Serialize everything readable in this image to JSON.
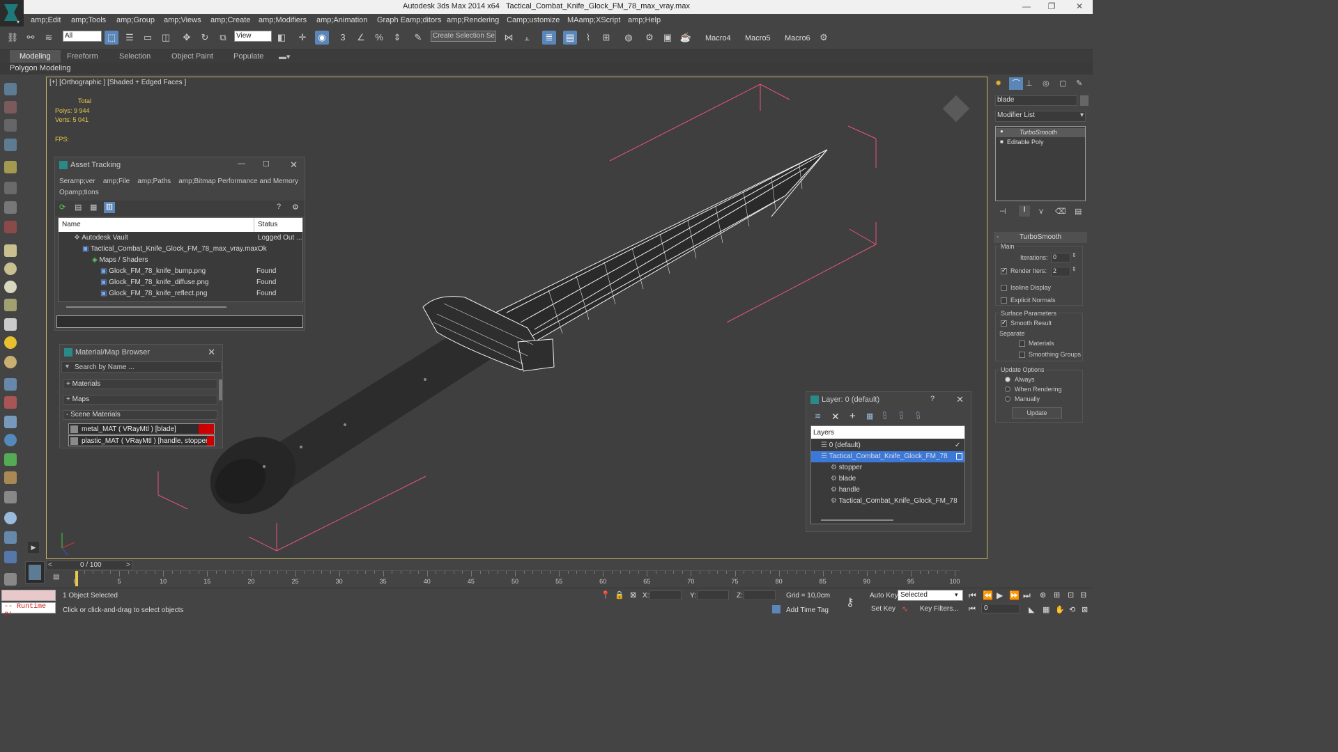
{
  "window": {
    "app_title": "Autodesk 3ds Max  2014 x64",
    "file_title": "Tactical_Combat_Knife_Glock_FM_78_max_vray.max"
  },
  "menu": [
    "amp;Edit",
    "amp;Tools",
    "amp;Group",
    "amp;Views",
    "amp;Create",
    "amp;Modifiers",
    "amp;Animation",
    "Graph Eamp;ditors",
    "amp;Rendering",
    "Camp;ustomize",
    "MAamp;XScript",
    "amp;Help"
  ],
  "toolbar": {
    "filter_select": "All",
    "ref_coord_select": "View",
    "selection_set": "Create Selection Se",
    "macros": [
      "Macro4",
      "Macro5",
      "Macro6"
    ]
  },
  "ribbon": {
    "tabs": [
      "Modeling",
      "Freeform",
      "Selection",
      "Object Paint",
      "Populate"
    ],
    "sub_label": "Polygon Modeling"
  },
  "viewport": {
    "label": "[+] [Orthographic ] [Shaded + Edged Faces ]",
    "stats_header": "Total",
    "polys_label": "Polys:",
    "polys_value": "9 944",
    "verts_label": "Verts:",
    "verts_value": "5 041",
    "fps_label": "FPS:"
  },
  "asset_tracking": {
    "title": "Asset Tracking",
    "menu": [
      "Seramp;ver",
      "amp;File",
      "amp;Paths",
      "amp;Bitmap Performance and Memory",
      "Opamp;tions"
    ],
    "columns": [
      "Name",
      "Status"
    ],
    "rows": [
      {
        "name": "Autodesk Vault",
        "status": "Logged Out ..."
      },
      {
        "name": "Tactical_Combat_Knife_Glock_FM_78_max_vray.max",
        "status": "Ok"
      },
      {
        "name": "Maps / Shaders",
        "status": ""
      },
      {
        "name": "Glock_FM_78_knife_bump.png",
        "status": "Found"
      },
      {
        "name": "Glock_FM_78_knife_diffuse.png",
        "status": "Found"
      },
      {
        "name": "Glock_FM_78_knife_reflect.png",
        "status": "Found"
      }
    ]
  },
  "material_browser": {
    "title": "Material/Map Browser",
    "search_placeholder": "Search by Name ...",
    "categories": [
      "+ Materials",
      "+ Maps",
      "- Scene Materials"
    ],
    "items": [
      "metal_MAT  ( VRayMtl )  [blade]",
      "plastic_MAT  ( VRayMtl )  [handle, stopper]"
    ]
  },
  "layer_panel": {
    "title": "Layer: 0 (default)",
    "help": "?",
    "header": "Layers",
    "items": [
      "0 (default)",
      "Tactical_Combat_Knife_Glock_FM_78",
      "stopper",
      "blade",
      "handle",
      "Tactical_Combat_Knife_Glock_FM_78"
    ]
  },
  "command_panel": {
    "object_name": "blade",
    "modifier_list": "Modifier List",
    "stack": [
      "TurboSmooth",
      "Editable Poly"
    ],
    "rollout_title": "TurboSmooth",
    "main_label": "Main",
    "iterations_label": "Iterations:",
    "iterations_value": "0",
    "render_iters_label": "Render Iters:",
    "render_iters_value": "2",
    "isoline_label": "Isoline Display",
    "explicit_normals_label": "Explicit Normals",
    "surface_params_label": "Surface Parameters",
    "smooth_result_label": "Smooth Result",
    "separate_label": "Separate",
    "materials_label": "Materials",
    "smoothing_groups_label": "Smoothing Groups",
    "update_options_label": "Update Options",
    "always_label": "Always",
    "when_rendering_label": "When Rendering",
    "manually_label": "Manually",
    "update_button": "Update"
  },
  "timeline": {
    "frame_display": "0 / 100",
    "ticks": [
      "0",
      "5",
      "10",
      "15",
      "20",
      "25",
      "30",
      "35",
      "40",
      "45",
      "50",
      "55",
      "60",
      "65",
      "70",
      "75",
      "80",
      "85",
      "90",
      "95",
      "100"
    ]
  },
  "status": {
    "runtime": "-- Runtime e:",
    "selected": "1 Object Selected",
    "prompt": "Click or click-and-drag to select objects",
    "x_label": "X:",
    "y_label": "Y:",
    "z_label": "Z:",
    "grid": "Grid = 10,0cm",
    "add_time_tag": "Add Time Tag",
    "auto_key": "Auto Key",
    "set_key": "Set Key",
    "key_mode": "Selected",
    "key_filters": "Key Filters...",
    "frame": "0"
  }
}
